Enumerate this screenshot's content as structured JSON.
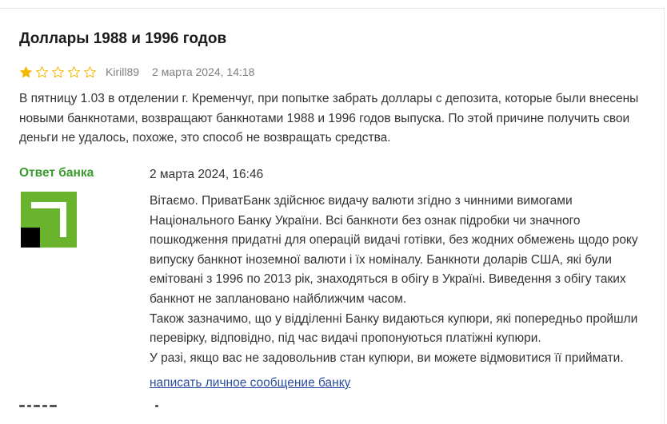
{
  "review": {
    "title": "Доллары 1988 и 1996 годов",
    "rating": 1,
    "max_rating": 5,
    "author": "Kirill89",
    "date": "2 марта 2024, 14:18",
    "text": "В пятницу 1.03 в отделении г. Кременчуг, при попытке забрать доллары с депозита, которые были внесены новыми банкнотами, возвращают банкнотами 1988 и 1996 годов выпуска. По этой причине получить свои деньги не удалось, похоже, это способ не возвращать средства."
  },
  "answer": {
    "label": "Ответ банка",
    "date": "2 марта 2024, 16:46",
    "paragraphs": [
      "Вітаємо. ПриватБанк здійснює видачу валюти згідно з чинними вимогами Національного Банку України. Всі банкноти без ознак підробки чи значного пошкодження придатні для операцій видачі готівки, без жодних обмежень щодо року випуску банкнот іноземної валюти і їх номіналу. Банкноти доларів США, які були емітовані з 1996 по 2013 рік, знаходяться в обігу в Україні. Виведення з обігу таких банкнот не заплановано найближчим часом.",
      "Також зазначимо, що у відділенні Банку видаються купюри, які попередньо пройшли перевірку, відповідно, під час видачі пропонуються платіжні купюри.",
      "У разі, якщо вас не задовольнив стан купюри, ви можете відмовитися її приймати."
    ],
    "link_label": "написать личное сообщение банку"
  },
  "colors": {
    "star_filled": "#f5b800",
    "star_empty_stroke": "#f5b800",
    "answer_label": "#3a9a2e",
    "link": "#2a4ea0",
    "logo_green": "#6ab42d",
    "logo_black": "#000000"
  },
  "icons": {
    "star_filled": "star-filled-icon",
    "star_empty": "star-outline-icon",
    "bank_logo": "privatbank-logo"
  }
}
